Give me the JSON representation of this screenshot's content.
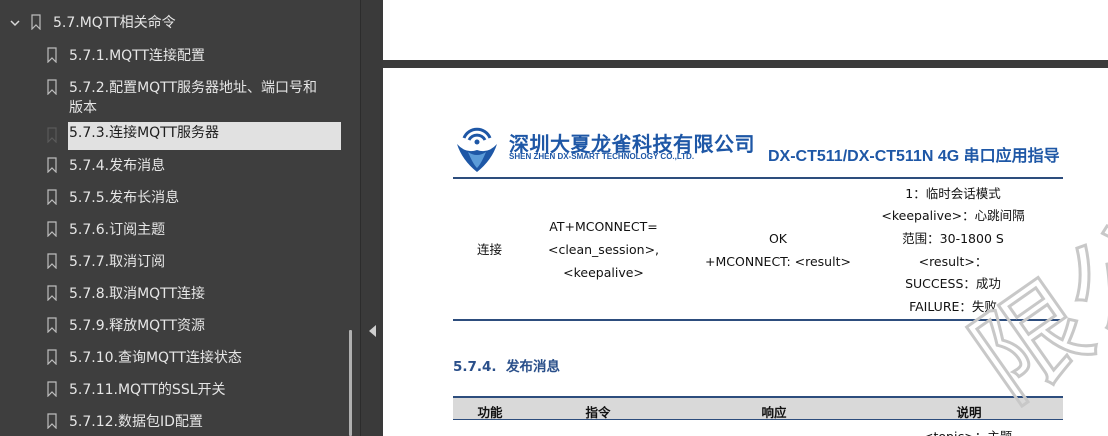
{
  "sidebar": {
    "parent": {
      "label": "5.7.MQTT相关命令",
      "expanded": true
    },
    "items": [
      {
        "label": "5.7.1.MQTT连接配置"
      },
      {
        "label_line1": "5.7.2.配置MQTT服务器地址、端口号和",
        "label_line2": "版本"
      },
      {
        "label": "5.7.3.连接MQTT服务器",
        "selected": true
      },
      {
        "label": "5.7.4.发布消息"
      },
      {
        "label": "5.7.5.发布长消息"
      },
      {
        "label": "5.7.6.订阅主题"
      },
      {
        "label": "5.7.7.取消订阅"
      },
      {
        "label": "5.7.8.取消MQTT连接"
      },
      {
        "label": "5.7.9.释放MQTT资源"
      },
      {
        "label": "5.7.10.查询MQTT连接状态"
      },
      {
        "label": "5.7.11.MQTT的SSL开关"
      },
      {
        "label": "5.7.12.数据包ID配置"
      }
    ]
  },
  "document": {
    "header": {
      "company_cn": "深圳大夏龙雀科技有限公司",
      "company_en": "SHEN ZHEN DX-SMART TECHNOLOGY CO.,LTD.",
      "title": "DX-CT511/DX-CT511N 4G 串口应用指导"
    },
    "table_row": {
      "function": "连接",
      "command_lines": [
        "AT+MCONNECT=",
        "<clean_session>,",
        "<keepalive>"
      ],
      "response_lines": [
        "OK",
        "+MCONNECT: <result>"
      ],
      "description_lines": [
        "1：临时会话模式",
        "<keepalive>：心跳间隔",
        "范围：30-1800 S",
        "<result>：",
        "SUCCESS：成功",
        "FAILURE：失败"
      ]
    },
    "section": {
      "number": "5.7.4.",
      "title": "发布消息"
    },
    "next_table": {
      "headers": [
        "功能",
        "指令",
        "响应",
        "说明"
      ],
      "peek_text": "<topic>：主题"
    },
    "watermark_text": "限公司"
  },
  "colors": {
    "sidebar_bg": "#3e3e3e",
    "sidebar_text": "#e6e6e6",
    "selected_bg": "#e1e1e1",
    "brand_blue": "#1e57a6",
    "rule": "#2d4d7d",
    "th_bg": "#d9d9d9"
  },
  "icons": {
    "bookmark": "bookmark-icon",
    "chevron": "chevron-down-icon",
    "collapse": "triangle-left-icon",
    "logo": "dx-smart-logo"
  }
}
